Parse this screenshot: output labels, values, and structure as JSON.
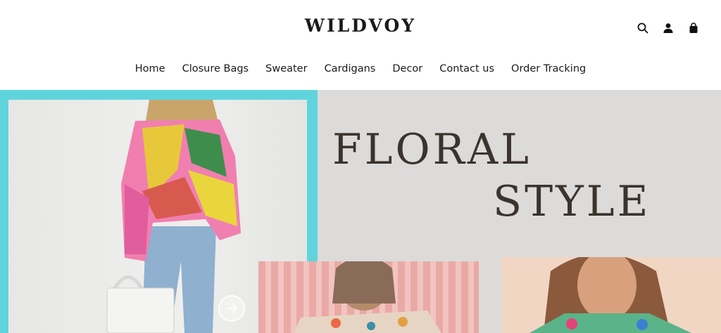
{
  "brand": {
    "logo_text": "WILDVOY"
  },
  "header": {
    "icons": [
      "search-icon",
      "account-icon",
      "cart-icon"
    ]
  },
  "nav": {
    "items": [
      {
        "label": "Home"
      },
      {
        "label": "Closure Bags"
      },
      {
        "label": "Sweater"
      },
      {
        "label": "Cardigans"
      },
      {
        "label": "Decor"
      },
      {
        "label": "Contact us"
      },
      {
        "label": "Order Tracking"
      }
    ]
  },
  "hero": {
    "headline_line1": "FLORAL",
    "headline_line2": "STYLE",
    "colors": {
      "accent_teal": "#5fd4dd",
      "background": "#dcdbd9",
      "headline": "#3b332d"
    }
  }
}
